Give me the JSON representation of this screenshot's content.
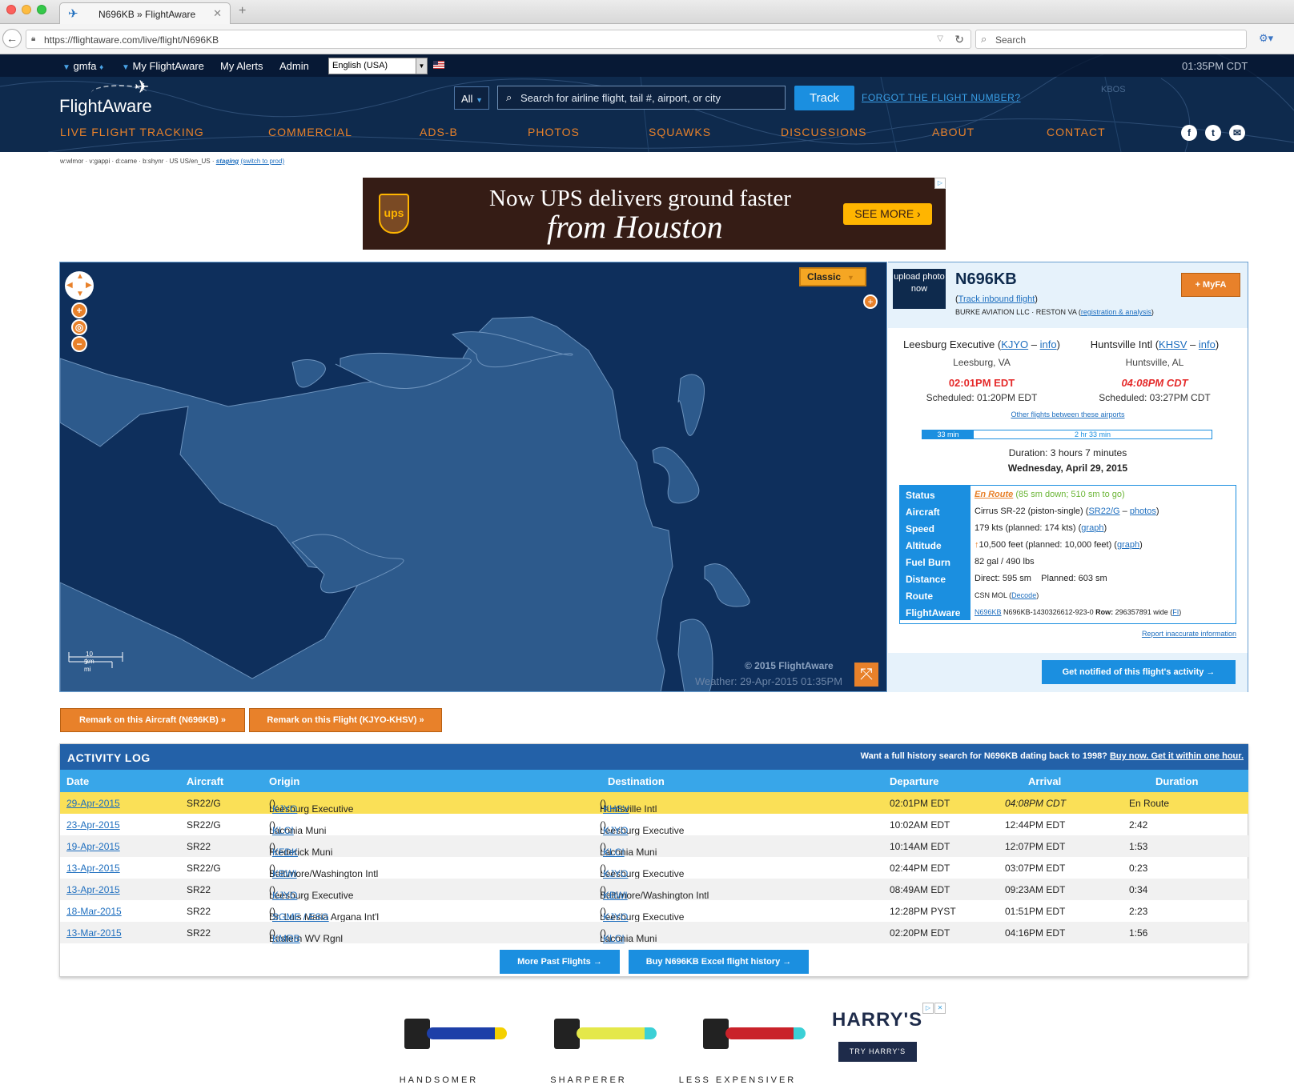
{
  "browser": {
    "tab_title": "N696KB » FlightAware",
    "url": "https://flightaware.com/live/flight/N696KB",
    "search_placeholder": "Search"
  },
  "topbar": {
    "user": "gmfa",
    "my_flightaware": "My FlightAware",
    "my_alerts": "My Alerts",
    "admin": "Admin",
    "language": "English (USA)",
    "clock": "01:35PM CDT"
  },
  "header": {
    "logo": "FlightAware",
    "search_scope": "All",
    "search_placeholder": "Search for airline flight, tail #, airport, or city",
    "track_button": "Track",
    "forgot_link": "FORGOT THE FLIGHT NUMBER?",
    "nav": [
      "LIVE FLIGHT TRACKING",
      "COMMERCIAL",
      "ADS-B",
      "PHOTOS",
      "SQUAWKS",
      "DISCUSSIONS",
      "ABOUT",
      "CONTACT"
    ]
  },
  "debug": {
    "text": "w:wlmor · v:gappi · d:carne · b:shynr · US US/en_US ·",
    "staging": "staging",
    "switch": "(switch to prod)"
  },
  "ad_top": {
    "logo": "ups",
    "line1": "Now UPS delivers ground faster",
    "line2": "from Houston",
    "button": "SEE MORE ›"
  },
  "map": {
    "layer_button": "Classic",
    "scale_km": "10 km",
    "scale_mi": "5 mi",
    "copyright": "© 2015 FlightAware",
    "weather": "Weather: 29-Apr-2015 01:35PM"
  },
  "flight": {
    "upload_photo": "upload photo now",
    "tail": "N696KB",
    "track_inbound": "Track inbound flight",
    "owner": "BURKE AVIATION LLC · RESTON VA",
    "owner_link": "registration & analysis",
    "myfa_button": "+ MyFA",
    "origin": {
      "name": "Leesburg Executive",
      "code": "KJYO",
      "info": "info",
      "city": "Leesburg, VA",
      "time": "02:01PM EDT",
      "scheduled": "Scheduled: 01:20PM EDT"
    },
    "destination": {
      "name": "Huntsville Intl",
      "code": "KHSV",
      "info": "info",
      "city": "Huntsville, AL",
      "time": "04:08PM CDT",
      "scheduled": "Scheduled: 03:27PM CDT"
    },
    "other_flights": "Other flights between these airports",
    "elapsed": "33 min",
    "remaining": "2 hr 33 min",
    "progress_fraction": 0.176,
    "duration": "Duration: 3 hours 7 minutes",
    "date": "Wednesday, April 29, 2015",
    "details": {
      "status_label": "Status",
      "status_value": "En Route",
      "status_extra": "(85 sm down; 510 sm to go)",
      "aircraft_label": "Aircraft",
      "aircraft_value": "Cirrus SR-22 (piston-single) (",
      "aircraft_code": "SR22/G",
      "aircraft_photos": "photos",
      "speed_label": "Speed",
      "speed_value": "179 kts (planned: 174 kts) (",
      "speed_graph": "graph",
      "altitude_label": "Altitude",
      "altitude_value": "10,500 feet (planned: 10,000 feet) (",
      "altitude_graph": "graph",
      "fuel_label": "Fuel Burn",
      "fuel_value": "82 gal / 490 lbs",
      "distance_label": "Distance",
      "distance_value": "Direct: 595 sm    Planned: 603 sm",
      "route_label": "Route",
      "route_value": "CSN MOL (",
      "route_decode": "Decode",
      "fa_label": "FlightAware",
      "fa_link": "N696KB",
      "fa_value": "N696KB-1430326612-923-0",
      "fa_row_label": "Row:",
      "fa_row": "296357891 wide (",
      "fa_fi": "FI"
    },
    "report": "Report inaccurate information",
    "notify_button": "Get notified of this flight's activity →"
  },
  "remarks": {
    "aircraft": "Remark on this Aircraft (N696KB) »",
    "flight": "Remark on this Flight (KJYO-KHSV) »"
  },
  "activity_log": {
    "title": "ACTIVITY LOG",
    "promo": "Want a full history search for N696KB dating back to 1998?",
    "promo_link": "Buy now. Get it within one hour.",
    "columns": [
      "Date",
      "Aircraft",
      "Origin",
      "Destination",
      "Departure",
      "Arrival",
      "Duration"
    ],
    "rows": [
      {
        "date": "29-Apr-2015",
        "aircraft": "SR22/G",
        "origin": "Leesburg Executive",
        "origin_code": "KJYO",
        "dest": "Huntsville Intl",
        "dest_code": "KHSV",
        "dep": "02:01PM EDT",
        "arr": "04:08PM CDT",
        "dur": "En Route"
      },
      {
        "date": "23-Apr-2015",
        "aircraft": "SR22/G",
        "origin": "Laconia Muni",
        "origin_code": "KLCI",
        "dest": "Leesburg Executive",
        "dest_code": "KJYO",
        "dep": "10:02AM EDT",
        "arr": "12:44PM EDT",
        "dur": "2:42"
      },
      {
        "date": "19-Apr-2015",
        "aircraft": "SR22",
        "origin": "Frederick Muni",
        "origin_code": "KFDK",
        "dest": "Laconia Muni",
        "dest_code": "KLCI",
        "dep": "10:14AM EDT",
        "arr": "12:07PM EDT",
        "dur": "1:53"
      },
      {
        "date": "13-Apr-2015",
        "aircraft": "SR22/G",
        "origin": "Baltimore/Washington Intl",
        "origin_code": "KBWI",
        "dest": "Leesburg Executive",
        "dest_code": "KJYO",
        "dep": "02:44PM EDT",
        "arr": "03:07PM EDT",
        "dur": "0:23"
      },
      {
        "date": "13-Apr-2015",
        "aircraft": "SR22",
        "origin": "Leesburg Executive",
        "origin_code": "KJYO",
        "dest": "Baltimore/Washington Intl",
        "dest_code": "KBWI",
        "dep": "08:49AM EDT",
        "arr": "09:23AM EDT",
        "dur": "0:34"
      },
      {
        "date": "18-Mar-2015",
        "aircraft": "SR22",
        "origin": "Dr. Luis Maria Argana Int'l",
        "origin_code": "SGME / ESG",
        "dest": "Leesburg Executive",
        "dest_code": "KJYO",
        "dep": "12:28PM PYST",
        "arr": "01:51PM EDT",
        "dur": "2:23"
      },
      {
        "date": "13-Mar-2015",
        "aircraft": "SR22",
        "origin": "Eastern WV Rgnl",
        "origin_code": "KMRB",
        "dest": "Laconia Muni",
        "dest_code": "KLCI",
        "dep": "02:20PM EDT",
        "arr": "04:16PM EDT",
        "dur": "1:56"
      }
    ],
    "more_button": "More Past Flights →",
    "buy_button": "Buy N696KB Excel flight history →"
  },
  "ad_bottom": {
    "captions": [
      "HANDSOMER",
      "SHARPERER",
      "LESS EXPENSIVER"
    ],
    "brand": "HARRY'S",
    "button": "TRY HARRY'S"
  },
  "colors": {
    "accent": "#e8812a",
    "blue": "#1b8fe0",
    "header": "#0e2a4d",
    "highlight": "#fae057"
  }
}
